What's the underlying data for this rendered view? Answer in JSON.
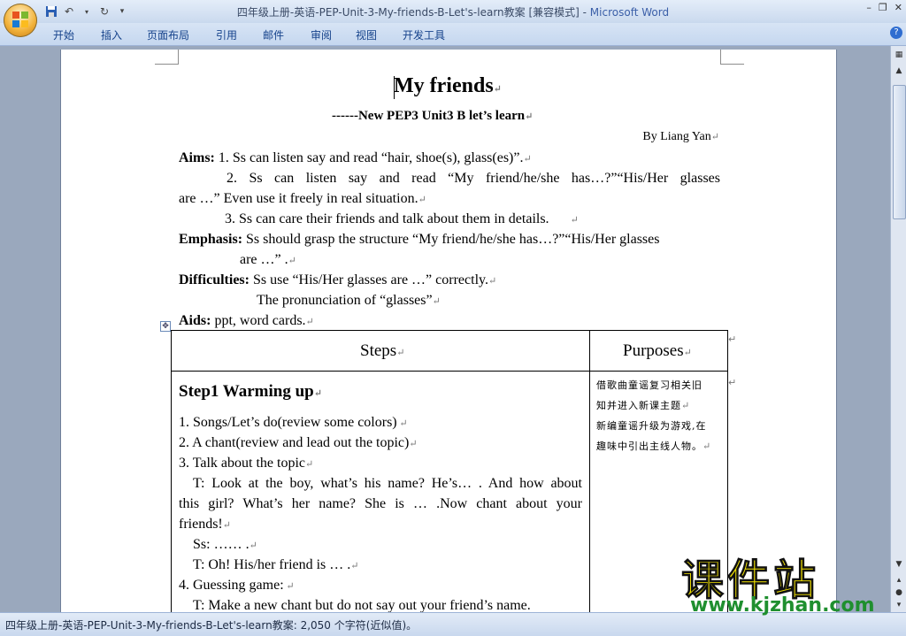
{
  "window": {
    "title": "四年级上册-英语-PEP-Unit-3-My-friends-B-Let's-learn教案 [兼容模式] - ",
    "app_name": "Microsoft Word",
    "minimize": "–",
    "restore": "❐",
    "close": "✕"
  },
  "ribbon": {
    "tabs": [
      "开始",
      "插入",
      "页面布局",
      "引用",
      "邮件",
      "审阅",
      "视图",
      "开发工具"
    ],
    "help": "?"
  },
  "document": {
    "title": "My friends",
    "subtitle": "------New PEP3 Unit3 B let’s learn",
    "author": "By Liang Yan",
    "aims_label": "Aims:",
    "aims_1": " 1. Ss can listen say and read “hair, shoe(s), glass(es)”.",
    "aims_2a": "2. Ss can listen say and read “My friend/he/she has…?”“His/Her glasses",
    "aims_2b": "are …” Even use it freely in real situation.",
    "aims_3": "3. Ss can care their friends and talk about them in details.",
    "emphasis_label": "Emphasis:",
    "emphasis_a": " Ss should grasp the structure “My friend/he/she has…?”“His/Her glasses",
    "emphasis_b": "are …” .",
    "difficulties_label": "Difficulties:",
    "difficulties_a": " Ss use “His/Her glasses are …” correctly.",
    "difficulties_b": "The pronunciation of “glasses”",
    "aids_label": "Aids:",
    "aids": " ppt, word cards.",
    "table": {
      "col1_header": "Steps",
      "col2_header": "Purposes",
      "step_title": "Step1 Warming up",
      "rows": [
        "1. Songs/Let’s do(review some colors)",
        "2. A chant(review and lead out the topic)",
        "3. Talk about the topic",
        "T: Look at the boy, what’s his name? He’s… . And how about",
        "this girl? What’s her name? She is … .Now chant about your",
        "friends!",
        "Ss: …… .",
        "T: Oh! His/her friend is … .",
        "4. Guessing game:",
        "T: Make a new chant but do not say out your friend’s name."
      ],
      "purposes": [
        "借歌曲童谣复习相关旧",
        "知并进入新课主题",
        "新编童谣升级为游戏,在",
        "趣味中引出主线人物。"
      ]
    }
  },
  "status_bar": {
    "text": "四年级上册-英语-PEP-Unit-3-My-friends-B-Let's-learn教案: 2,050 个字符(近似值)。"
  },
  "watermark": {
    "cn": "课件站",
    "url": "www.kjzhan.com"
  }
}
